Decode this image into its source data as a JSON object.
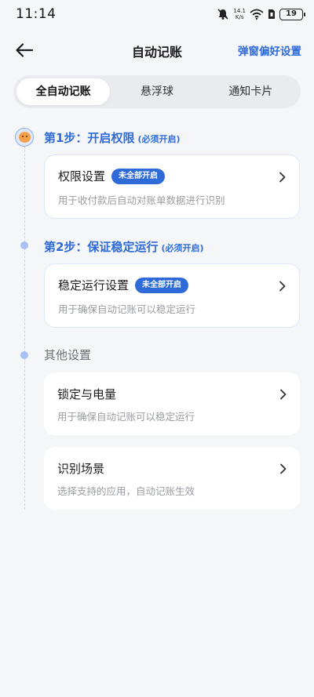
{
  "status": {
    "time": "11:14",
    "net_speed_value": "14.1",
    "net_speed_unit": "K/s",
    "battery": "19",
    "icons": [
      "mute-bell-icon",
      "wifi-icon",
      "sim-icon",
      "battery-icon"
    ]
  },
  "header": {
    "title": "自动记账",
    "pref_link": "弹窗偏好设置"
  },
  "tabs": [
    {
      "label": "全自动记账",
      "active": true
    },
    {
      "label": "悬浮球",
      "active": false
    },
    {
      "label": "通知卡片",
      "active": false
    }
  ],
  "steps": [
    {
      "title": "第1步：开启权限",
      "required": "(必须开启)",
      "card": {
        "title": "权限设置",
        "badge": "未全部开启",
        "desc": "用于收付款后自动对账单数据进行识别"
      }
    },
    {
      "title": "第2步：保证稳定运行",
      "required": "(必须开启)",
      "card": {
        "title": "稳定运行设置",
        "badge": "未全部开启",
        "desc": "用于确保自动记账可以稳定运行"
      }
    }
  ],
  "other": {
    "title": "其他设置",
    "cards": [
      {
        "title": "锁定与电量",
        "desc": "用于确保自动记账可以稳定运行"
      },
      {
        "title": "识别场景",
        "desc": "选择支持的应用，自动记账生效"
      }
    ]
  },
  "colors": {
    "accent": "#2f6bd8",
    "background": "#f5f6f8",
    "card": "#ffffff",
    "muted_text": "#9a9ca3"
  }
}
